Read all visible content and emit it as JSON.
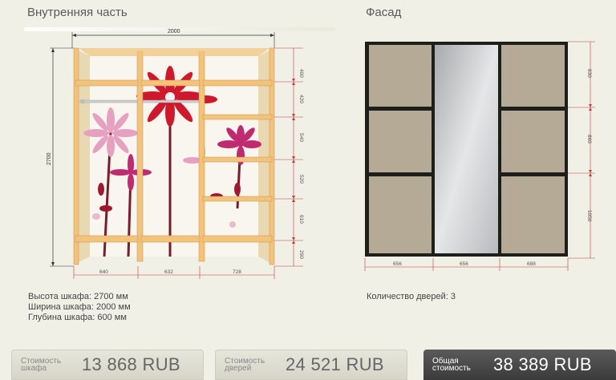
{
  "sections": {
    "inner_title": "Внутренняя часть",
    "facade_title": "Фасад"
  },
  "inner": {
    "width_dim": "2000",
    "height_dim": "2700",
    "right_dims": [
      "400",
      "420",
      "540",
      "520",
      "610",
      "290"
    ],
    "bottom_dims": [
      "640",
      "632",
      "728"
    ]
  },
  "facade": {
    "right_dims": [
      "830",
      "860",
      "1050"
    ],
    "bottom_dims": [
      "656",
      "656",
      "688"
    ],
    "colors": {
      "frame": "#1e1e1a",
      "panel": "#b5aa95",
      "mirror": "#c7c9cc"
    }
  },
  "specs": {
    "height": "Высота шкафа: 2700 мм",
    "width": "Ширина шкафа: 2000 мм",
    "depth": "Глубина шкафа: 600 мм"
  },
  "doors": {
    "count_text": "Количество дверей: 3"
  },
  "prices": {
    "cabinet": {
      "label_line1": "Стоимость",
      "label_line2": "шкафа",
      "value": "13 868  RUB"
    },
    "doors": {
      "label_line1": "Стоимость",
      "label_line2": "дверей",
      "value": "24 521  RUB"
    },
    "total": {
      "label_line1": "Общая",
      "label_line2": "стоимость",
      "value": "38 389  RUB"
    }
  }
}
